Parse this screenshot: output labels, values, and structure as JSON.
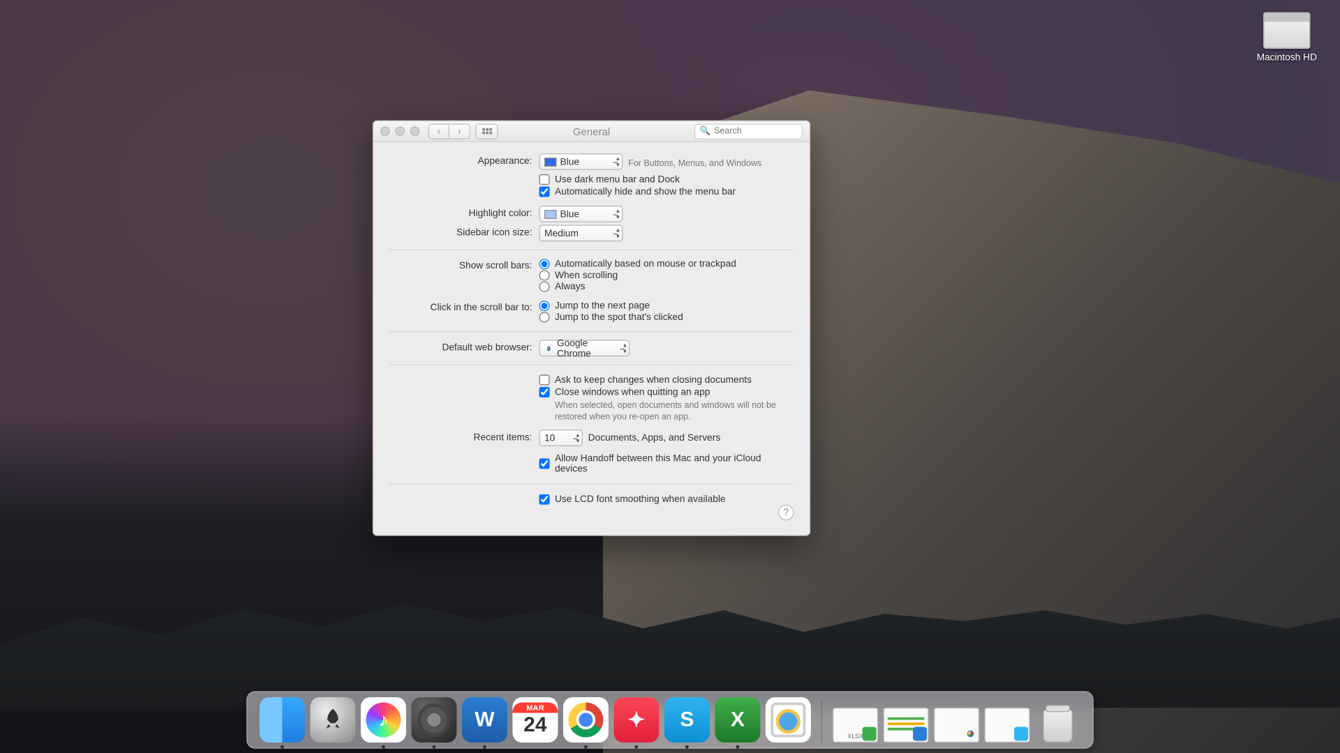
{
  "desktop": {
    "hd_label": "Macintosh HD"
  },
  "window": {
    "title": "General",
    "search_placeholder": "Search"
  },
  "prefs": {
    "appearance_label": "Appearance:",
    "appearance_value": "Blue",
    "appearance_hint": "For Buttons, Menus, and Windows",
    "dark_menu_label": "Use dark menu bar and Dock",
    "dark_menu_checked": false,
    "autohide_label": "Automatically hide and show the menu bar",
    "autohide_checked": true,
    "highlight_label": "Highlight color:",
    "highlight_value": "Blue",
    "sidebar_label": "Sidebar icon size:",
    "sidebar_value": "Medium",
    "scrollbars_label": "Show scroll bars:",
    "scroll_opts": {
      "auto": "Automatically based on mouse or trackpad",
      "scrolling": "When scrolling",
      "always": "Always"
    },
    "scrollbars_selected": "auto",
    "click_label": "Click in the scroll bar to:",
    "click_opts": {
      "next": "Jump to the next page",
      "spot": "Jump to the spot that's clicked"
    },
    "click_selected": "next",
    "browser_label": "Default web browser:",
    "browser_value": "Google Chrome",
    "ask_keep_label": "Ask to keep changes when closing documents",
    "ask_keep_checked": false,
    "close_win_label": "Close windows when quitting an app",
    "close_win_checked": true,
    "close_win_desc": "When selected, open documents and windows will not be restored when you re-open an app.",
    "recent_label": "Recent items:",
    "recent_value": "10",
    "recent_hint": "Documents, Apps, and Servers",
    "handoff_label": "Allow Handoff between this Mac and your iCloud devices",
    "handoff_checked": true,
    "lcd_label": "Use LCD font smoothing when available",
    "lcd_checked": true,
    "help": "?"
  },
  "dock": {
    "cal_month": "MAR",
    "cal_day": "24",
    "word_letter": "W",
    "excel_letter": "X",
    "skype_letter": "S",
    "minis": {
      "xlsx_label": "XLSX"
    }
  }
}
